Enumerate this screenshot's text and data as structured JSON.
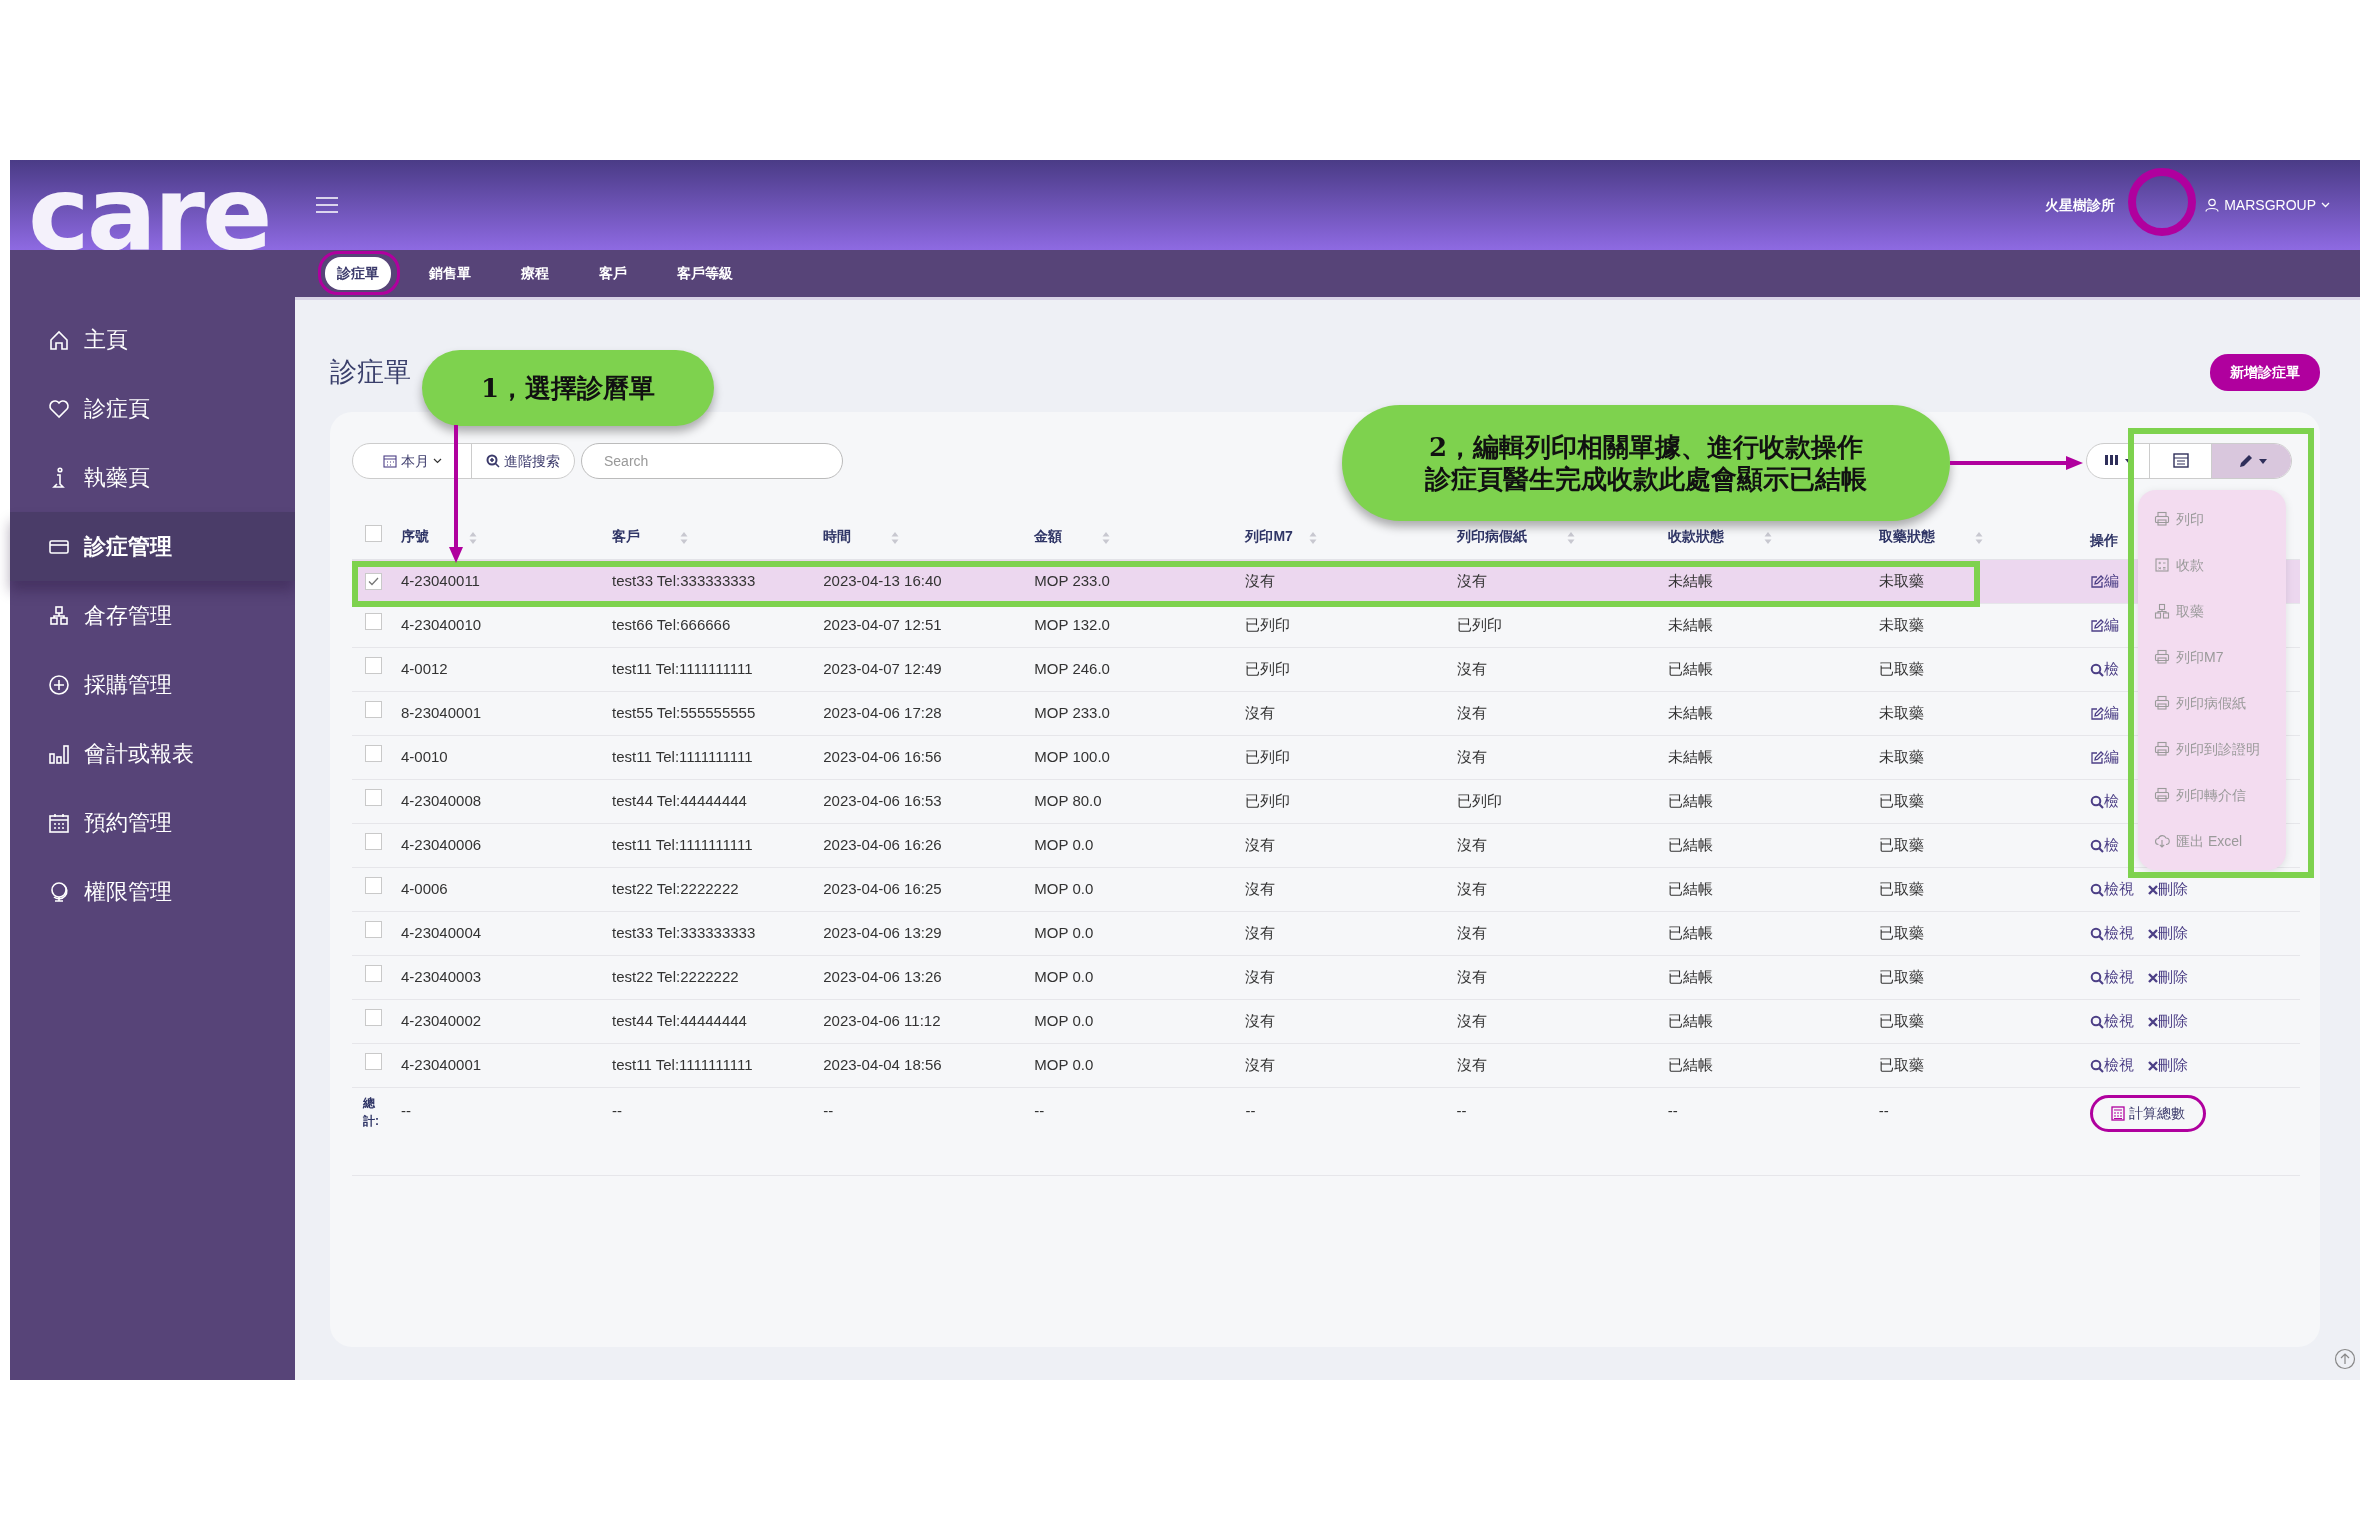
{
  "header": {
    "logo": "care",
    "clinic": "火星樹診所",
    "user": "MARSGROUP"
  },
  "tabs": [
    {
      "label": "診症單",
      "selected": true
    },
    {
      "label": "銷售單",
      "selected": false
    },
    {
      "label": "療程",
      "selected": false
    },
    {
      "label": "客戶",
      "selected": false
    },
    {
      "label": "客戶等級",
      "selected": false
    }
  ],
  "sidebar": {
    "items": [
      {
        "kind": "home",
        "label": "主頁",
        "selected": false
      },
      {
        "kind": "heart",
        "label": "診症頁",
        "selected": false
      },
      {
        "kind": "flask",
        "label": "執藥頁",
        "selected": false
      },
      {
        "kind": "card",
        "label": "診症管理",
        "selected": true
      },
      {
        "kind": "boxes",
        "label": "倉存管理",
        "selected": false
      },
      {
        "kind": "plus",
        "label": "採購管理",
        "selected": false
      },
      {
        "kind": "bars",
        "label": "會計或報表",
        "selected": false
      },
      {
        "kind": "calendar",
        "label": "預約管理",
        "selected": false
      },
      {
        "kind": "globe",
        "label": "權限管理",
        "selected": false
      }
    ]
  },
  "page": {
    "title": "診症單",
    "new_button": "新增診症單"
  },
  "toolbar": {
    "period": "本月",
    "advanced_search": "進階搜索",
    "search": {
      "placeholder": "Search"
    },
    "buttons": [
      {
        "kind": "columns",
        "expanded": false
      },
      {
        "kind": "table",
        "expanded": false
      },
      {
        "kind": "edit",
        "expanded": true
      }
    ],
    "menu": [
      {
        "kind": "print",
        "label": "列印",
        "disabled": true
      },
      {
        "kind": "cash",
        "label": "收款",
        "disabled": true
      },
      {
        "kind": "boxes",
        "label": "取藥",
        "disabled": true
      },
      {
        "kind": "print",
        "label": "列印M7",
        "disabled": true
      },
      {
        "kind": "print",
        "label": "列印病假紙",
        "disabled": true
      },
      {
        "kind": "print",
        "label": "列印到診證明",
        "disabled": true
      },
      {
        "kind": "print",
        "label": "列印轉介信",
        "disabled": true
      },
      {
        "kind": "cloud",
        "label": "匯出 Excel",
        "disabled": true
      }
    ]
  },
  "table": {
    "select_all": {
      "checked": false
    },
    "columns": [
      "序號",
      "客戶",
      "時間",
      "金額",
      "列印M7",
      "列印病假紙",
      "收款狀態",
      "取藥狀態",
      "操作"
    ],
    "rows": [
      {
        "selected": true,
        "cells": [
          "4-23040011",
          "test33 Tel:333333333",
          "2023-04-13 16:40",
          "MOP 233.0",
          "沒有",
          "沒有",
          "未結帳",
          "未取藥"
        ],
        "actions": [
          {
            "kind": "edit",
            "label": "編"
          }
        ]
      },
      {
        "selected": false,
        "cells": [
          "4-23040010",
          "test66 Tel:666666",
          "2023-04-07 12:51",
          "MOP 132.0",
          "已列印",
          "已列印",
          "未結帳",
          "未取藥"
        ],
        "actions": [
          {
            "kind": "edit",
            "label": "編"
          }
        ]
      },
      {
        "selected": false,
        "cells": [
          "4-0012",
          "test11 Tel:1111111111",
          "2023-04-07 12:49",
          "MOP 246.0",
          "已列印",
          "沒有",
          "已結帳",
          "已取藥"
        ],
        "actions": [
          {
            "kind": "view",
            "label": "檢"
          }
        ]
      },
      {
        "selected": false,
        "cells": [
          "8-23040001",
          "test55 Tel:555555555",
          "2023-04-06 17:28",
          "MOP 233.0",
          "沒有",
          "沒有",
          "未結帳",
          "未取藥"
        ],
        "actions": [
          {
            "kind": "edit",
            "label": "編"
          }
        ]
      },
      {
        "selected": false,
        "cells": [
          "4-0010",
          "test11 Tel:1111111111",
          "2023-04-06 16:56",
          "MOP 100.0",
          "已列印",
          "沒有",
          "未結帳",
          "未取藥"
        ],
        "actions": [
          {
            "kind": "edit",
            "label": "編"
          }
        ]
      },
      {
        "selected": false,
        "cells": [
          "4-23040008",
          "test44 Tel:44444444",
          "2023-04-06 16:53",
          "MOP 80.0",
          "已列印",
          "已列印",
          "已結帳",
          "已取藥"
        ],
        "actions": [
          {
            "kind": "view",
            "label": "檢"
          }
        ]
      },
      {
        "selected": false,
        "cells": [
          "4-23040006",
          "test11 Tel:1111111111",
          "2023-04-06 16:26",
          "MOP 0.0",
          "沒有",
          "沒有",
          "已結帳",
          "已取藥"
        ],
        "actions": [
          {
            "kind": "view",
            "label": "檢"
          }
        ]
      },
      {
        "selected": false,
        "cells": [
          "4-0006",
          "test22 Tel:2222222",
          "2023-04-06 16:25",
          "MOP 0.0",
          "沒有",
          "沒有",
          "已結帳",
          "已取藥"
        ],
        "actions": [
          {
            "kind": "view",
            "label": "檢視"
          },
          {
            "kind": "delete",
            "label": "刪除"
          }
        ]
      },
      {
        "selected": false,
        "cells": [
          "4-23040004",
          "test33 Tel:333333333",
          "2023-04-06 13:29",
          "MOP 0.0",
          "沒有",
          "沒有",
          "已結帳",
          "已取藥"
        ],
        "actions": [
          {
            "kind": "view",
            "label": "檢視"
          },
          {
            "kind": "delete",
            "label": "刪除"
          }
        ]
      },
      {
        "selected": false,
        "cells": [
          "4-23040003",
          "test22 Tel:2222222",
          "2023-04-06 13:26",
          "MOP 0.0",
          "沒有",
          "沒有",
          "已結帳",
          "已取藥"
        ],
        "actions": [
          {
            "kind": "view",
            "label": "檢視"
          },
          {
            "kind": "delete",
            "label": "刪除"
          }
        ]
      },
      {
        "selected": false,
        "cells": [
          "4-23040002",
          "test44 Tel:44444444",
          "2023-04-06 11:12",
          "MOP 0.0",
          "沒有",
          "沒有",
          "已結帳",
          "已取藥"
        ],
        "actions": [
          {
            "kind": "view",
            "label": "檢視"
          },
          {
            "kind": "delete",
            "label": "刪除"
          }
        ]
      },
      {
        "selected": false,
        "cells": [
          "4-23040001",
          "test11 Tel:1111111111",
          "2023-04-04 18:56",
          "MOP 0.0",
          "沒有",
          "沒有",
          "已結帳",
          "已取藥"
        ],
        "actions": [
          {
            "kind": "view",
            "label": "檢視"
          },
          {
            "kind": "delete",
            "label": "刪除"
          }
        ]
      }
    ],
    "total": {
      "label": "總計:",
      "cells": [
        "--",
        "--",
        "--",
        "--",
        "--",
        "--",
        "--",
        "--"
      ],
      "button": "計算總數"
    }
  },
  "annotations": {
    "callouts": [
      {
        "lines": [
          "1，選擇診曆單"
        ]
      },
      {
        "lines": [
          "2，編輯列印相關單據、進行收款操作",
          "診症頁醫生完成收款此處會顯示已結帳"
        ]
      }
    ]
  }
}
